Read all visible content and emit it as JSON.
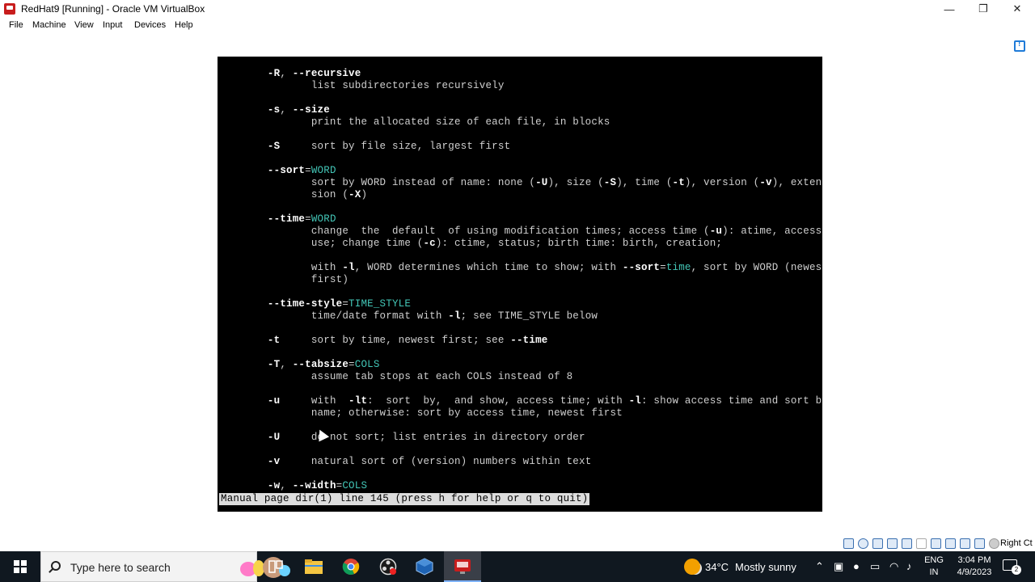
{
  "window": {
    "title": "RedHat9 [Running] - Oracle VM VirtualBox",
    "minimize_glyph": "—",
    "maximize_glyph": "❐",
    "close_glyph": "✕"
  },
  "menubar": {
    "items": [
      "File",
      "Machine",
      "View",
      "Input",
      "Devices",
      "Help"
    ]
  },
  "console": {
    "lines": [
      {
        "indent": "       ",
        "parts": [
          {
            "t": "-R",
            "s": "b"
          },
          {
            "t": ", ",
            "s": ""
          },
          {
            "t": "--recursive",
            "s": "b"
          }
        ]
      },
      {
        "indent": "              ",
        "parts": [
          {
            "t": "list subdirectories recursively",
            "s": ""
          }
        ]
      },
      {
        "indent": "",
        "parts": []
      },
      {
        "indent": "       ",
        "parts": [
          {
            "t": "-s",
            "s": "b"
          },
          {
            "t": ", ",
            "s": ""
          },
          {
            "t": "--size",
            "s": "b"
          }
        ]
      },
      {
        "indent": "              ",
        "parts": [
          {
            "t": "print the allocated size of each file, in blocks",
            "s": ""
          }
        ]
      },
      {
        "indent": "",
        "parts": []
      },
      {
        "indent": "       ",
        "parts": [
          {
            "t": "-S",
            "s": "b"
          },
          {
            "t": "     sort by file size, largest first",
            "s": ""
          }
        ]
      },
      {
        "indent": "",
        "parts": []
      },
      {
        "indent": "       ",
        "parts": [
          {
            "t": "--sort",
            "s": "b"
          },
          {
            "t": "=",
            "s": ""
          },
          {
            "t": "WORD",
            "s": "g"
          }
        ]
      },
      {
        "indent": "              ",
        "parts": [
          {
            "t": "sort by WORD instead of name: none (",
            "s": ""
          },
          {
            "t": "-U",
            "s": "b"
          },
          {
            "t": "), size (",
            "s": ""
          },
          {
            "t": "-S",
            "s": "b"
          },
          {
            "t": "), time (",
            "s": ""
          },
          {
            "t": "-t",
            "s": "b"
          },
          {
            "t": "), version (",
            "s": ""
          },
          {
            "t": "-v",
            "s": "b"
          },
          {
            "t": "), exten-",
            "s": ""
          }
        ]
      },
      {
        "indent": "              ",
        "parts": [
          {
            "t": "sion (",
            "s": ""
          },
          {
            "t": "-X",
            "s": "b"
          },
          {
            "t": ")",
            "s": ""
          }
        ]
      },
      {
        "indent": "",
        "parts": []
      },
      {
        "indent": "       ",
        "parts": [
          {
            "t": "--time",
            "s": "b"
          },
          {
            "t": "=",
            "s": ""
          },
          {
            "t": "WORD",
            "s": "g"
          }
        ]
      },
      {
        "indent": "              ",
        "parts": [
          {
            "t": "change  the  default  of using modification times; access time (",
            "s": ""
          },
          {
            "t": "-u",
            "s": "b"
          },
          {
            "t": "): atime, access,",
            "s": ""
          }
        ]
      },
      {
        "indent": "              ",
        "parts": [
          {
            "t": "use; change time (",
            "s": ""
          },
          {
            "t": "-c",
            "s": "b"
          },
          {
            "t": "): ctime, status; birth time: birth, creation;",
            "s": ""
          }
        ]
      },
      {
        "indent": "",
        "parts": []
      },
      {
        "indent": "              ",
        "parts": [
          {
            "t": "with ",
            "s": ""
          },
          {
            "t": "-l",
            "s": "b"
          },
          {
            "t": ", WORD determines which time to show; with ",
            "s": ""
          },
          {
            "t": "--sort",
            "s": "b"
          },
          {
            "t": "=",
            "s": ""
          },
          {
            "t": "time",
            "s": "g"
          },
          {
            "t": ", sort by WORD (newest",
            "s": ""
          }
        ]
      },
      {
        "indent": "              ",
        "parts": [
          {
            "t": "first)",
            "s": ""
          }
        ]
      },
      {
        "indent": "",
        "parts": []
      },
      {
        "indent": "       ",
        "parts": [
          {
            "t": "--time-style",
            "s": "b"
          },
          {
            "t": "=",
            "s": ""
          },
          {
            "t": "TIME_STYLE",
            "s": "g"
          }
        ]
      },
      {
        "indent": "              ",
        "parts": [
          {
            "t": "time/date format with ",
            "s": ""
          },
          {
            "t": "-l",
            "s": "b"
          },
          {
            "t": "; see TIME_STYLE below",
            "s": ""
          }
        ]
      },
      {
        "indent": "",
        "parts": []
      },
      {
        "indent": "       ",
        "parts": [
          {
            "t": "-t",
            "s": "b"
          },
          {
            "t": "     sort by time, newest first; see ",
            "s": ""
          },
          {
            "t": "--time",
            "s": "b"
          }
        ]
      },
      {
        "indent": "",
        "parts": []
      },
      {
        "indent": "       ",
        "parts": [
          {
            "t": "-T",
            "s": "b"
          },
          {
            "t": ", ",
            "s": ""
          },
          {
            "t": "--tabsize",
            "s": "b"
          },
          {
            "t": "=",
            "s": ""
          },
          {
            "t": "COLS",
            "s": "g"
          }
        ]
      },
      {
        "indent": "              ",
        "parts": [
          {
            "t": "assume tab stops at each COLS instead of 8",
            "s": ""
          }
        ]
      },
      {
        "indent": "",
        "parts": []
      },
      {
        "indent": "       ",
        "parts": [
          {
            "t": "-u",
            "s": "b"
          },
          {
            "t": "     with  ",
            "s": ""
          },
          {
            "t": "-lt",
            "s": "b"
          },
          {
            "t": ":  sort  by,  and show, access time; with ",
            "s": ""
          },
          {
            "t": "-l",
            "s": "b"
          },
          {
            "t": ": show access time and sort by",
            "s": ""
          }
        ]
      },
      {
        "indent": "              ",
        "parts": [
          {
            "t": "name; otherwise: sort by access time, newest first",
            "s": ""
          }
        ]
      },
      {
        "indent": "",
        "parts": []
      },
      {
        "indent": "       ",
        "parts": [
          {
            "t": "-U",
            "s": "b"
          },
          {
            "t": "     do not sort; list entries in directory order",
            "s": ""
          }
        ]
      },
      {
        "indent": "",
        "parts": []
      },
      {
        "indent": "       ",
        "parts": [
          {
            "t": "-v",
            "s": "b"
          },
          {
            "t": "     natural sort of (version) numbers within text",
            "s": ""
          }
        ]
      },
      {
        "indent": "",
        "parts": []
      },
      {
        "indent": "       ",
        "parts": [
          {
            "t": "-w",
            "s": "b"
          },
          {
            "t": ", ",
            "s": ""
          },
          {
            "t": "--width",
            "s": "b"
          },
          {
            "t": "=",
            "s": ""
          },
          {
            "t": "COLS",
            "s": "g"
          }
        ]
      }
    ],
    "status_line": "Manual page dir(1) line 145 (press h for help or q to quit)"
  },
  "vbox_status": {
    "host_key_label": "Right Ct"
  },
  "taskbar": {
    "search_placeholder": "Type here to search",
    "apps": [
      "task-view",
      "file-explorer",
      "chrome",
      "obs-studio",
      "virtualbox-manager",
      "virtualbox-vm"
    ],
    "weather": {
      "temp": "34°C",
      "condition": "Mostly sunny"
    },
    "language": {
      "line1": "ENG",
      "line2": "IN"
    },
    "clock": {
      "time": "3:04 PM",
      "date": "4/9/2023"
    },
    "notification_count": "2"
  },
  "colors": {
    "console_bg": "#000000",
    "console_text": "#cfcfcf",
    "console_highlight": "#43c6b7",
    "taskbar_bg": "#101820"
  }
}
